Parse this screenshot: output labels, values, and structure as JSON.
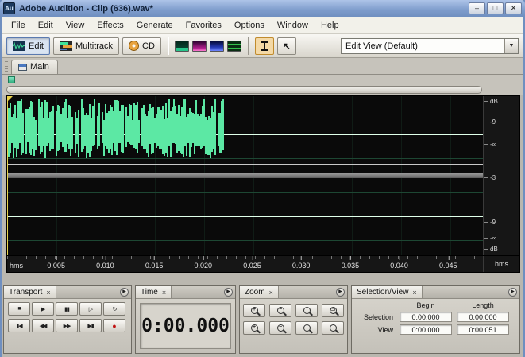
{
  "window": {
    "title": "Adobe Audition - Clip (636).wav*",
    "app_initials": "Au",
    "controls": {
      "minimize": "–",
      "maximize": "□",
      "close": "✕"
    }
  },
  "menu": {
    "items": [
      "File",
      "Edit",
      "View",
      "Effects",
      "Generate",
      "Favorites",
      "Options",
      "Window",
      "Help"
    ]
  },
  "toolbar": {
    "edit": "Edit",
    "multitrack": "Multitrack",
    "cd": "CD",
    "view_selector": "Edit View (Default)",
    "dropdown_arrow": "▼"
  },
  "tab": {
    "main": "Main"
  },
  "ruler": {
    "labels": [
      "dB",
      "-9",
      "-∞",
      "-3",
      "-9",
      "-∞",
      "dB"
    ]
  },
  "timeline": {
    "left_unit": "hms",
    "right_unit": "hms",
    "ticks": [
      "0.005",
      "0.010",
      "0.015",
      "0.020",
      "0.025",
      "0.030",
      "0.035",
      "0.040",
      "0.045"
    ]
  },
  "waveform": {
    "active_fraction": 0.455,
    "channels": 2,
    "color": "#5ce8a4"
  },
  "panels": {
    "transport": {
      "title": "Transport",
      "close": "×",
      "menu_glyph": "▶",
      "row1": [
        {
          "name": "stop",
          "glyph": "■"
        },
        {
          "name": "play",
          "glyph": "▶"
        },
        {
          "name": "pause",
          "glyph": "▮▮"
        },
        {
          "name": "play-from-cursor",
          "glyph": "▷"
        },
        {
          "name": "play-looped",
          "glyph": "↻"
        }
      ],
      "row2": [
        {
          "name": "go-to-beginning",
          "glyph": "▮◀"
        },
        {
          "name": "rewind",
          "glyph": "◀◀"
        },
        {
          "name": "fast-forward",
          "glyph": "▶▶"
        },
        {
          "name": "go-to-end",
          "glyph": "▶▮"
        },
        {
          "name": "record",
          "glyph": "●"
        }
      ]
    },
    "time": {
      "title": "Time",
      "close": "×",
      "menu_glyph": "▶",
      "value": "0:00.000"
    },
    "zoom": {
      "title": "Zoom",
      "close": "×",
      "menu_glyph": "▶",
      "marks": [
        "+",
        "−",
        "",
        "▭",
        "+",
        "−",
        "",
        ""
      ]
    },
    "selection_view": {
      "title": "Selection/View",
      "close": "×",
      "menu_glyph": "▶",
      "columns": {
        "begin": "Begin",
        "length": "Length"
      },
      "rows": {
        "selection": {
          "label": "Selection",
          "begin": "0:00.000",
          "length": "0:00.000"
        },
        "view": {
          "label": "View",
          "begin": "0:00.000",
          "length": "0:00.051"
        }
      }
    }
  }
}
